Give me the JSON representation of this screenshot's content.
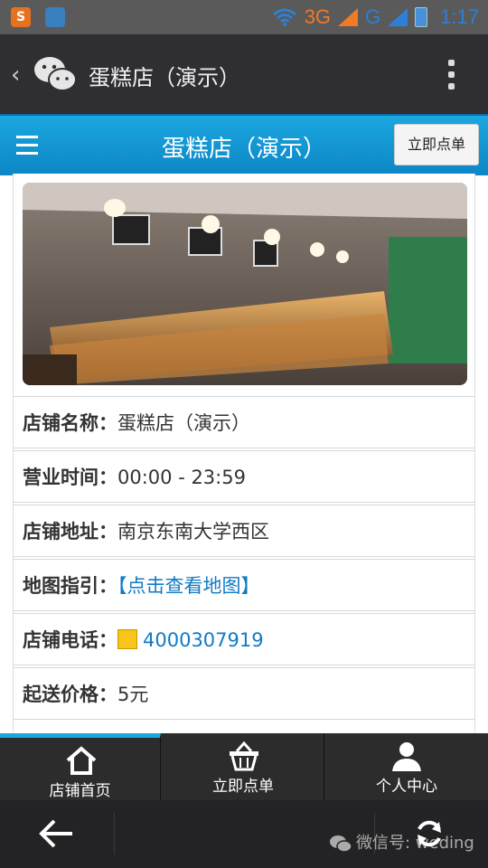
{
  "statusbar": {
    "app1_icon": "sogou-app-icon",
    "app2_icon": "gallery-app-icon",
    "network1": "3G",
    "network2": "G",
    "time": "1:17",
    "icons": [
      "wifi-icon",
      "signal-icon",
      "battery-icon"
    ]
  },
  "wechat_bar": {
    "title": "蛋糕店（演示）",
    "back_icon": "back-chevron-icon",
    "logo_icon": "wechat-icon",
    "more_icon": "more-vertical-icon"
  },
  "header": {
    "title": "蛋糕店（演示）",
    "order_button": "立即点单",
    "menu_icon": "hamburger-menu-icon"
  },
  "shop_info": {
    "rows": [
      {
        "label": "店铺名称：",
        "value": "蛋糕店（演示）"
      },
      {
        "label": "营业时间：",
        "value": "00:00 - 23:59"
      },
      {
        "label": "店铺地址：",
        "value": "南京东南大学西区"
      },
      {
        "label": "地图指引：",
        "value": "【点击查看地图】"
      },
      {
        "label": "店铺电话：",
        "value": "4000307919"
      },
      {
        "label": "起送价格：",
        "value": "5元"
      }
    ]
  },
  "tabbar": {
    "tabs": [
      {
        "label": "店铺首页",
        "icon": "home-icon"
      },
      {
        "label": "立即点单",
        "icon": "basket-icon"
      },
      {
        "label": "个人中心",
        "icon": "user-icon"
      }
    ]
  },
  "navbar": {
    "back_icon": "back-arrow-icon",
    "refresh_icon": "refresh-icon",
    "watermark": "微信号: weding"
  },
  "colors": {
    "header_blue": "#1aa7e0",
    "link_blue": "#0f7bc4",
    "wechat_dark": "#2f2f33"
  }
}
